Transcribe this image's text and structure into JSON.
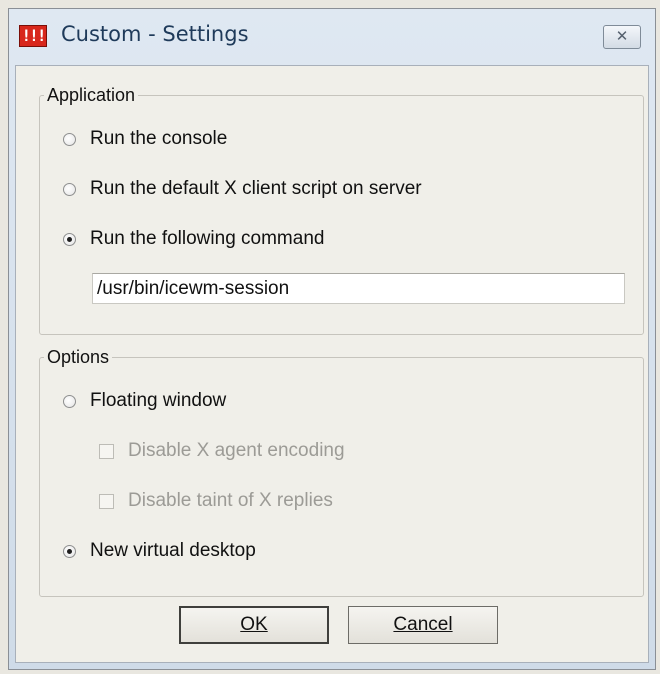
{
  "window": {
    "title": "Custom - Settings",
    "icon_text": "!!!",
    "close_glyph": "✕"
  },
  "application": {
    "legend": "Application",
    "options": [
      {
        "label": "Run the console",
        "checked": false
      },
      {
        "label": "Run the default X client script on server",
        "checked": false
      },
      {
        "label": "Run the following command",
        "checked": true
      }
    ],
    "command_value": "/usr/bin/icewm-session"
  },
  "options": {
    "legend": "Options",
    "floating_window": {
      "label": "Floating window",
      "checked": false
    },
    "disable_agent_encoding": {
      "label": "Disable X agent encoding",
      "checked": false,
      "enabled": false
    },
    "disable_taint": {
      "label": "Disable taint of X replies",
      "checked": false,
      "enabled": false
    },
    "new_virtual_desktop": {
      "label": "New virtual desktop",
      "checked": true
    }
  },
  "buttons": {
    "ok": "OK",
    "cancel": "Cancel"
  }
}
